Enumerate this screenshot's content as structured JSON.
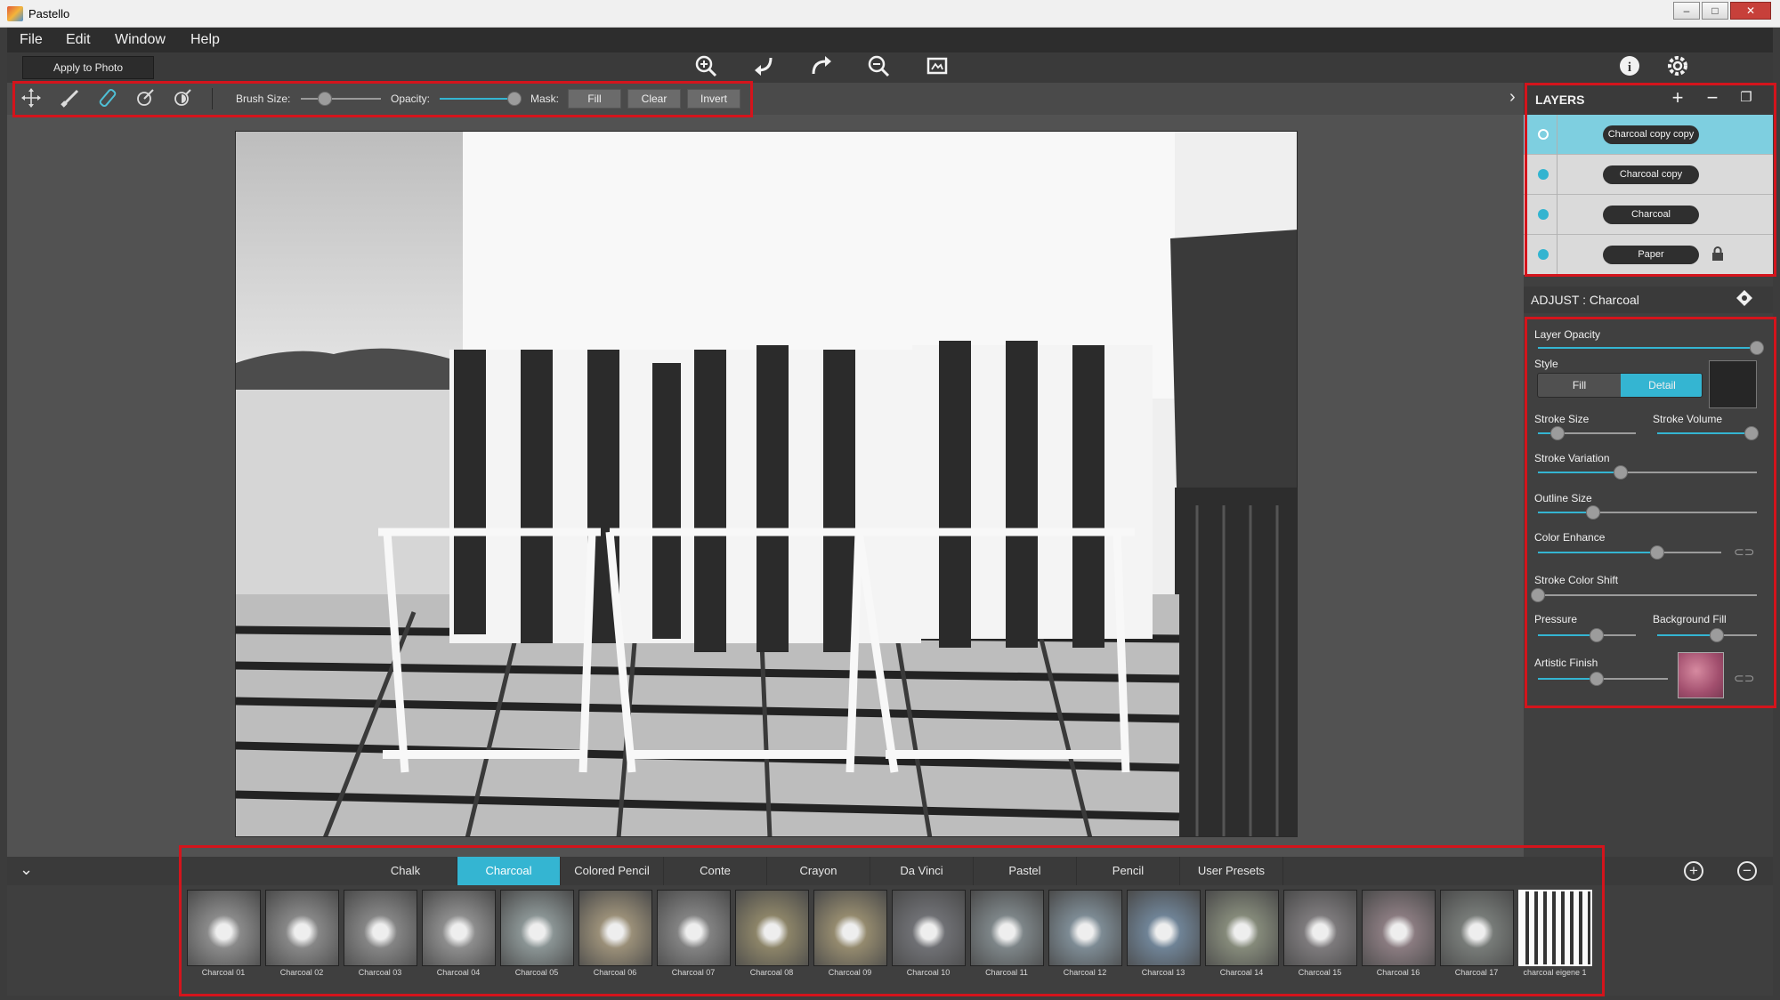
{
  "window": {
    "title": "Pastello",
    "controls": [
      "–",
      "□",
      "✕"
    ]
  },
  "menu": [
    "File",
    "Edit",
    "Window",
    "Help"
  ],
  "toolbar": {
    "apply_label": "Apply to Photo",
    "center_icons": [
      "zoom-in-icon",
      "undo-icon",
      "redo-icon",
      "zoom-out-icon",
      "fit-screen-icon"
    ],
    "right_icons": [
      "info-icon",
      "settings-icon"
    ]
  },
  "brush": {
    "tools": [
      "move-icon",
      "brush-icon",
      "eraser-icon",
      "smudge-icon",
      "dodge-icon"
    ],
    "brush_size_label": "Brush Size:",
    "brush_size_value": 0.3,
    "opacity_label": "Opacity:",
    "opacity_value": 0.95,
    "mask_label": "Mask:",
    "mask_buttons": [
      "Fill",
      "Clear",
      "Invert"
    ]
  },
  "layers": {
    "title": "LAYERS",
    "items": [
      {
        "name": "Charcoal copy copy",
        "selected": true
      },
      {
        "name": "Charcoal copy",
        "selected": false
      },
      {
        "name": "Charcoal",
        "selected": false
      },
      {
        "name": "Paper",
        "selected": false,
        "locked": true
      }
    ]
  },
  "adjust": {
    "title": "ADJUST : Charcoal",
    "layer_opacity": {
      "label": "Layer Opacity",
      "value": 1.0
    },
    "style": {
      "label": "Style",
      "options": [
        "Fill",
        "Detail"
      ],
      "selected": "Detail"
    },
    "stroke_size": {
      "label": "Stroke Size",
      "value": 0.2
    },
    "stroke_volume": {
      "label": "Stroke Volume",
      "value": 0.95
    },
    "stroke_variation": {
      "label": "Stroke Variation",
      "value": 0.38
    },
    "outline_size": {
      "label": "Outline Size",
      "value": 0.25
    },
    "color_enhance": {
      "label": "Color Enhance",
      "value": 0.65
    },
    "stroke_color_shift": {
      "label": "Stroke Color Shift",
      "value": 0.0
    },
    "pressure": {
      "label": "Pressure",
      "value": 0.6
    },
    "background_fill": {
      "label": "Background Fill",
      "value": 0.6
    },
    "artistic_finish": {
      "label": "Artistic Finish",
      "value": 0.45
    }
  },
  "categories": {
    "tabs": [
      "Chalk",
      "Charcoal",
      "Colored Pencil",
      "Conte",
      "Crayon",
      "Da Vinci",
      "Pastel",
      "Pencil",
      "User Presets"
    ],
    "active": "Charcoal"
  },
  "presets": [
    {
      "label": "Charcoal 01",
      "color": "#8a8a8a"
    },
    {
      "label": "Charcoal 02",
      "color": "#878787"
    },
    {
      "label": "Charcoal 03",
      "color": "#858585"
    },
    {
      "label": "Charcoal 04",
      "color": "#8d8d8d"
    },
    {
      "label": "Charcoal 05",
      "color": "#8a9494"
    },
    {
      "label": "Charcoal 06",
      "color": "#9a8f78"
    },
    {
      "label": "Charcoal 07",
      "color": "#828282"
    },
    {
      "label": "Charcoal 08",
      "color": "#8c8468"
    },
    {
      "label": "Charcoal 09",
      "color": "#948a6e"
    },
    {
      "label": "Charcoal 10",
      "color": "#6f7074"
    },
    {
      "label": "Charcoal 11",
      "color": "#7d8588"
    },
    {
      "label": "Charcoal 12",
      "color": "#7d8b94"
    },
    {
      "label": "Charcoal 13",
      "color": "#6f8396"
    },
    {
      "label": "Charcoal 14",
      "color": "#858a7a"
    },
    {
      "label": "Charcoal 15",
      "color": "#7d7a7c"
    },
    {
      "label": "Charcoal 16",
      "color": "#8a7b80"
    },
    {
      "label": "Charcoal 17",
      "color": "#777b78"
    },
    {
      "label": "charcoal eigene 1",
      "color": "#d8d8d8"
    }
  ],
  "colors": {
    "accent": "#34b5d2",
    "highlight": "#d4141c"
  }
}
